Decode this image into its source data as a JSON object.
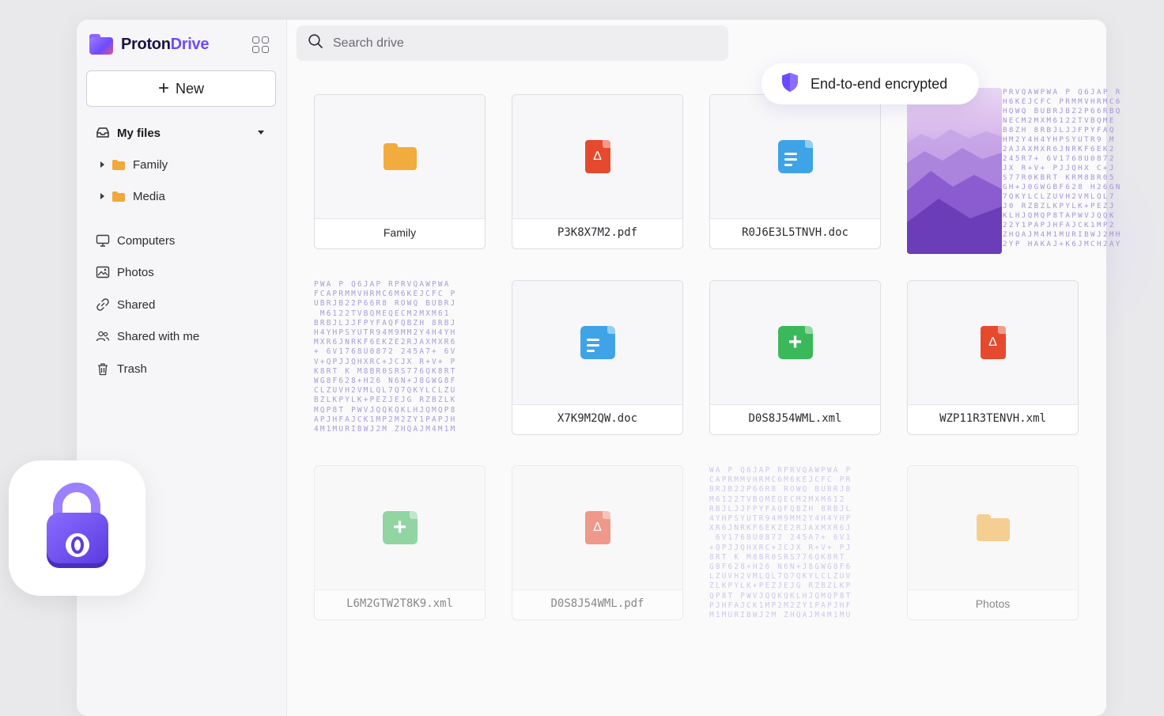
{
  "app": {
    "brand_part1": "Proton",
    "brand_part2": "Drive",
    "accent_color": "#6d4aff"
  },
  "sidebar": {
    "new_button_label": "New",
    "my_files_label": "My files",
    "tree": [
      {
        "label": "Family",
        "icon": "folder-icon"
      },
      {
        "label": "Media",
        "icon": "folder-icon"
      }
    ],
    "items": [
      {
        "label": "Computers",
        "icon": "monitor-icon"
      },
      {
        "label": "Photos",
        "icon": "image-icon"
      },
      {
        "label": "Shared",
        "icon": "link-icon"
      },
      {
        "label": "Shared with me",
        "icon": "users-icon"
      },
      {
        "label": "Trash",
        "icon": "trash-icon"
      }
    ]
  },
  "search": {
    "placeholder": "Search drive"
  },
  "badge": {
    "label": "End-to-end encrypted",
    "icon": "shield-icon"
  },
  "files": [
    {
      "name": "Family",
      "type": "folder"
    },
    {
      "name": "P3K8X7M2.pdf",
      "type": "pdf"
    },
    {
      "name": "R0J6E3L5TNVH.doc",
      "type": "doc"
    },
    {
      "name": "X7K9M2QW.doc",
      "type": "doc"
    },
    {
      "name": "D0S8J54WML.xml",
      "type": "xml"
    },
    {
      "name": "WZP11R3TENVH.xml",
      "type": "pdf"
    },
    {
      "name": "L6M2GTW2T8K9.xml",
      "type": "xml"
    },
    {
      "name": "D0S8J54WML.pdf",
      "type": "pdf"
    },
    {
      "name": "Photos",
      "type": "folder"
    }
  ]
}
